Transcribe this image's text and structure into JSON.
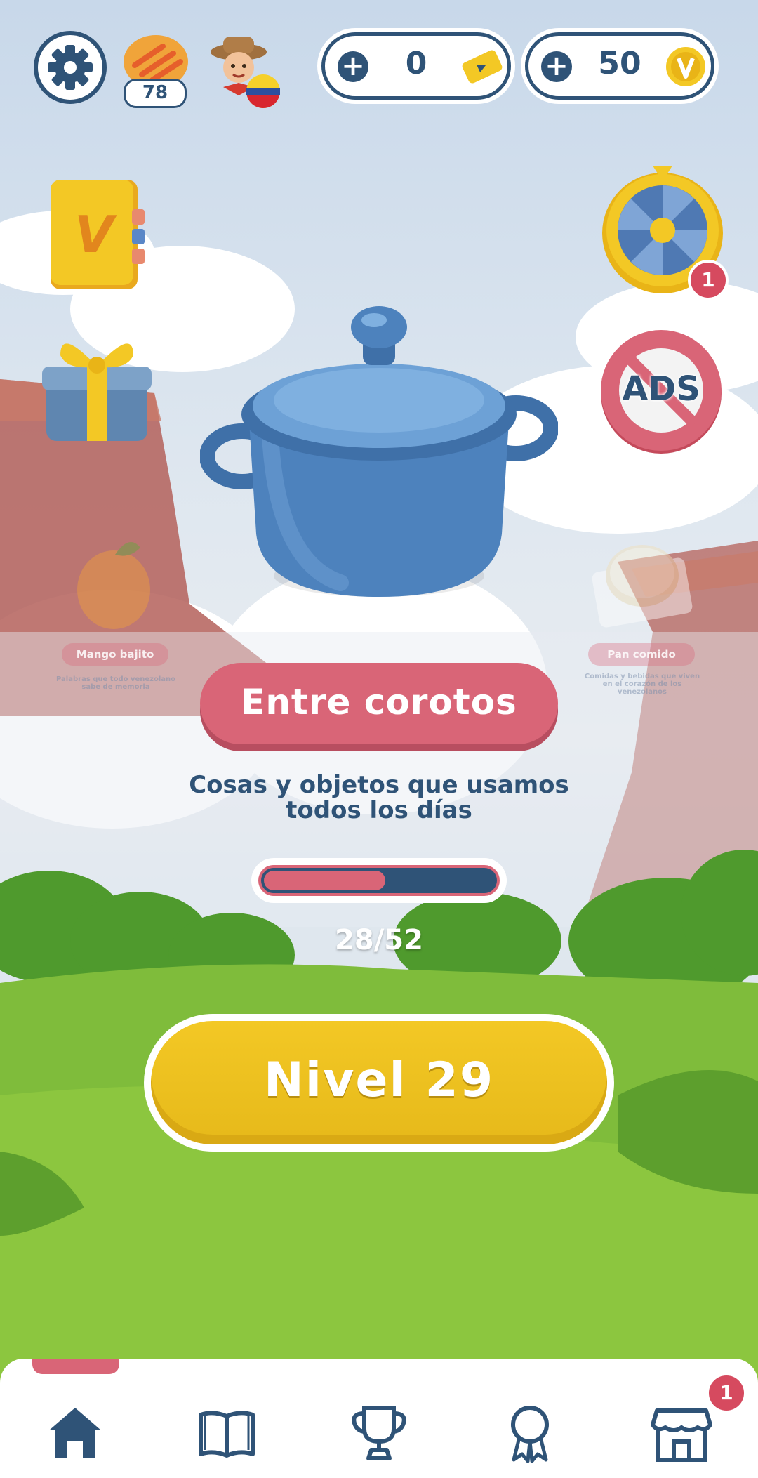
{
  "header": {
    "streak_count": "78",
    "tickets": {
      "value": "0"
    },
    "coins": {
      "value": "50"
    }
  },
  "side": {
    "wheel_badge": "1",
    "ads_label": "ADS",
    "dictionary_letter": "V"
  },
  "category": {
    "title": "Entre corotos",
    "subtitle": "Cosas y objetos que usamos todos los días",
    "progress_text": "28/52",
    "progress_fraction": 0.54
  },
  "neighbors": {
    "left_title": "Mango bajito",
    "left_desc": "Palabras que todo venezolano sabe de memoria",
    "right_title": "Pan comido",
    "right_desc": "Comidas y bebidas que viven en el corazón de los venezolanos"
  },
  "level_button": "Nivel 29",
  "nav": {
    "shop_badge": "1",
    "items": [
      "home-icon",
      "book-icon",
      "trophy-icon",
      "award-icon",
      "shop-icon"
    ]
  },
  "colors": {
    "primary": "#2f5377",
    "accent_pink": "#d96577",
    "gold": "#f3c825"
  }
}
